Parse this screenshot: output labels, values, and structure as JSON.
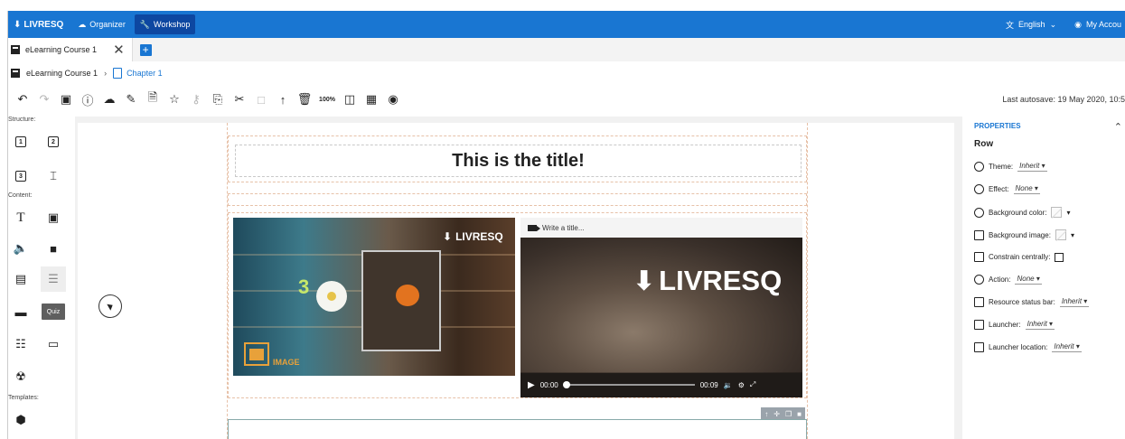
{
  "app": {
    "brand": "LIVRESQ",
    "nav": [
      {
        "label": "Organizer",
        "icon": "cloud-icon"
      },
      {
        "label": "Workshop",
        "icon": "wrench-icon"
      }
    ],
    "language": "English",
    "account": "My Accou"
  },
  "tab": {
    "label": "eLearning Course 1"
  },
  "breadcrumb": {
    "root": "eLearning Course 1",
    "current": "Chapter 1"
  },
  "toolbar": {
    "zoom": "100%",
    "autosave": "Last autosave: 19 May 2020, 10:5"
  },
  "palette": {
    "structure_label": "Structure:",
    "content_label": "Content:",
    "templates_label": "Templates:",
    "quiz_label": "Quiz",
    "column_numbers": [
      "1",
      "2",
      "3"
    ]
  },
  "canvas": {
    "title": "This is the title!",
    "image_brand": "LIVRESQ",
    "image_caption": "IMAGE",
    "image_number": "3",
    "video_placeholder": "Write a title...",
    "video_brand": "LIVRESQ",
    "video_time_current": "00:00",
    "video_time_total": "00:09",
    "video_progress": 0.02
  },
  "properties": {
    "header": "PROPERTIES",
    "element": "Row",
    "theme_label": "Theme:",
    "theme_value": "Inherit",
    "effect_label": "Effect:",
    "effect_value": "None",
    "bgcolor_label": "Background color:",
    "bgimage_label": "Background image:",
    "constrain_label": "Constrain centrally:",
    "action_label": "Action:",
    "action_value": "None",
    "statusbar_label": "Resource status bar:",
    "statusbar_value": "Inherit",
    "launcher_label": "Launcher:",
    "launcher_value": "Inherit",
    "launcherloc_label": "Launcher location:",
    "launcherloc_value": "Inherit"
  },
  "colors": {
    "topbar": "#1976d2",
    "accent": "#1976d2",
    "active_nav": "#0d47a1",
    "image_badge": "#e8a13a"
  }
}
